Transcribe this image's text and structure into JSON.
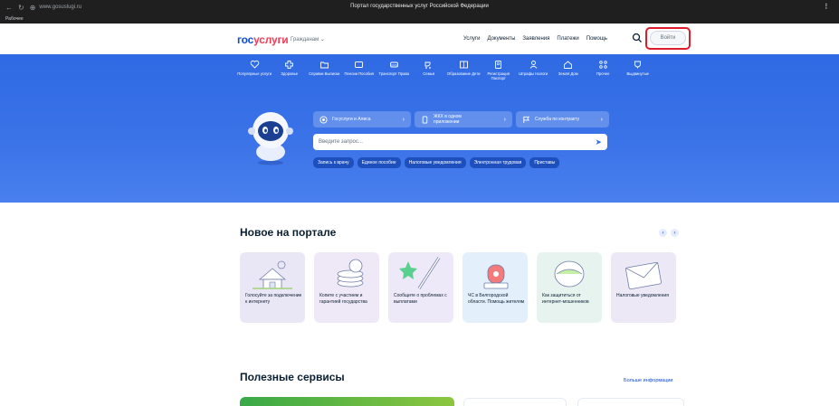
{
  "browser": {
    "url": "www.gosuslugi.ru",
    "title": "Портал государственных услуг Российской Федерации",
    "bookmark": "Рабочее"
  },
  "header": {
    "logo_part1": "гос",
    "logo_part2": "услуги",
    "persona": "Гражданам ⌄",
    "links": [
      "Услуги",
      "Документы",
      "Заявления",
      "Платежи",
      "Помощь"
    ],
    "login": "Войти"
  },
  "categories": [
    {
      "label": "Популярные услуги",
      "icon": "heart-icon"
    },
    {
      "label": "Здоровье",
      "icon": "health-cross-icon"
    },
    {
      "label": "Справки Выписки",
      "icon": "folder-icon"
    },
    {
      "label": "Пенсии Пособия",
      "icon": "wallet-icon"
    },
    {
      "label": "Транспорт Права",
      "icon": "car-icon"
    },
    {
      "label": "Семья",
      "icon": "stroller-icon"
    },
    {
      "label": "Образование Дети",
      "icon": "book-icon"
    },
    {
      "label": "Регистрация Паспорт",
      "icon": "passport-icon"
    },
    {
      "label": "Штрафы Налоги",
      "icon": "tax-icon"
    },
    {
      "label": "Земля Дом",
      "icon": "house-icon"
    },
    {
      "label": "Прочее",
      "icon": "grid-icon"
    },
    {
      "label": "Выдвинутые",
      "icon": "cup-icon"
    }
  ],
  "quick_actions": [
    {
      "label": "Госуслуги и Алиса",
      "icon": "alice-icon"
    },
    {
      "label": "ЖКХ в одном приложении",
      "icon": "phone-icon"
    },
    {
      "label": "Служба по контракту",
      "icon": "flag-icon"
    }
  ],
  "search": {
    "placeholder": "Введите запрос..."
  },
  "chips": [
    "Запись к врачу",
    "Единое пособие",
    "Налоговые уведомления",
    "Электронная трудовая",
    "Приставы"
  ],
  "new_section": {
    "title": "Новое на портале",
    "cards": [
      {
        "text": "Голосуйте за подключение к интернету",
        "bg": "#e9e6f6",
        "icon": "house-router-illustration"
      },
      {
        "text": "Копите с участием и гарантией государства",
        "bg": "#efe9f7",
        "icon": "coins-illustration"
      },
      {
        "text": "Сообщите о проблемах с выплатами",
        "bg": "#eee9f8",
        "icon": "pen-star-illustration"
      },
      {
        "text": "ЧС в Белгородской области. Помощь жителям",
        "bg": "#e3f0fb",
        "icon": "siren-illustration"
      },
      {
        "text": "Как защититься от интернет-мошенников",
        "bg": "#e7f3ef",
        "icon": "helmet-illustration"
      },
      {
        "text": "Налоговые уведомления",
        "bg": "#ece8f6",
        "icon": "envelope-illustration"
      }
    ]
  },
  "services_section": {
    "title": "Полезные сервисы",
    "more": "Больше информации"
  }
}
